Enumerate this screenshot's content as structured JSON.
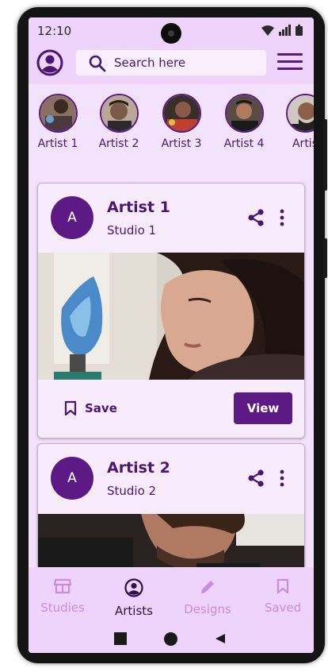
{
  "status_bar": {
    "time": "12:10"
  },
  "search": {
    "placeholder": "Search here"
  },
  "stories": [
    {
      "label": "Artist 1"
    },
    {
      "label": "Artist 2"
    },
    {
      "label": "Artist 3"
    },
    {
      "label": "Artist 4"
    },
    {
      "label": "Artis"
    }
  ],
  "cards": [
    {
      "avatar_letter": "A",
      "name": "Artist 1",
      "studio": "Studio 1",
      "save_label": "Save",
      "view_label": "View"
    },
    {
      "avatar_letter": "A",
      "name": "Artist 2",
      "studio": "Studio 2"
    }
  ],
  "bottom_nav": [
    {
      "label": "Studies",
      "icon": "store-icon",
      "active": false
    },
    {
      "label": "Artists",
      "icon": "account-circle-icon",
      "active": true
    },
    {
      "label": "Designs",
      "icon": "pencil-icon",
      "active": false
    },
    {
      "label": "Saved",
      "icon": "bookmark-icon",
      "active": false
    }
  ],
  "colors": {
    "primary": "#5d1a85",
    "surface": "#f3e2fb",
    "bar": "#eed4fa",
    "inactive": "#c98be3"
  }
}
